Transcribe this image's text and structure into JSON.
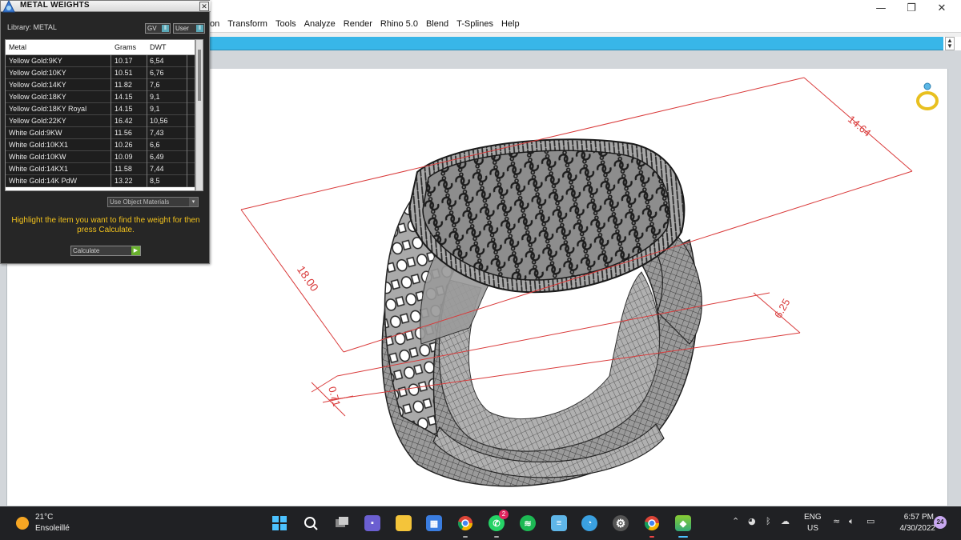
{
  "window": {
    "minimize": "—",
    "maximize": "❐",
    "close": "✕"
  },
  "menu": [
    "on",
    "Transform",
    "Tools",
    "Analyze",
    "Render",
    "Rhino 5.0",
    "Blend",
    "T-Splines",
    "Help"
  ],
  "panel": {
    "title": "METAL WEIGHTS",
    "close": "✕",
    "library_label": "Library: METAL",
    "toggle_gv": "GV",
    "toggle_user": "User",
    "columns": [
      "Metal",
      "Grams",
      "DWT"
    ],
    "rows": [
      {
        "metal": "Yellow Gold:9KY",
        "grams": "10.17",
        "dwt": "6,54"
      },
      {
        "metal": "Yellow Gold:10KY",
        "grams": "10.51",
        "dwt": "6,76"
      },
      {
        "metal": "Yellow Gold:14KY",
        "grams": "11.82",
        "dwt": "7,6"
      },
      {
        "metal": "Yellow Gold:18KY",
        "grams": "14.15",
        "dwt": "9,1"
      },
      {
        "metal": "Yellow Gold:18KY Royal",
        "grams": "14.15",
        "dwt": "9,1"
      },
      {
        "metal": "Yellow Gold:22KY",
        "grams": "16.42",
        "dwt": "10,56"
      },
      {
        "metal": "White Gold:9KW",
        "grams": "11.56",
        "dwt": "7,43"
      },
      {
        "metal": "White Gold:10KX1",
        "grams": "10.26",
        "dwt": "6,6"
      },
      {
        "metal": "White Gold:10KW",
        "grams": "10.09",
        "dwt": "6,49"
      },
      {
        "metal": "White Gold:14KX1",
        "grams": "11.58",
        "dwt": "7,44"
      },
      {
        "metal": "White Gold:14K PdW",
        "grams": "13.22",
        "dwt": "8,5"
      }
    ],
    "use_object_materials": "Use Object Materials",
    "hint": "Highlight the item you want to find the weight for then press Calculate.",
    "calculate": "Calculate"
  },
  "dimensions": {
    "d1": "14.64",
    "d2": "18.00",
    "d3": "6.25",
    "d4": "0.71"
  },
  "taskbar": {
    "temperature": "21°C",
    "weather": "Ensoleillé",
    "whatsapp_badge": "2",
    "lang_top": "ENG",
    "lang_bottom": "US",
    "time": "6:57 PM",
    "date": "4/30/2022",
    "notifications": "24"
  },
  "colors": {
    "accent": "#38b6e8",
    "dimension": "#d93a3a",
    "hint": "#f2c21c",
    "taskbar": "#202124"
  }
}
